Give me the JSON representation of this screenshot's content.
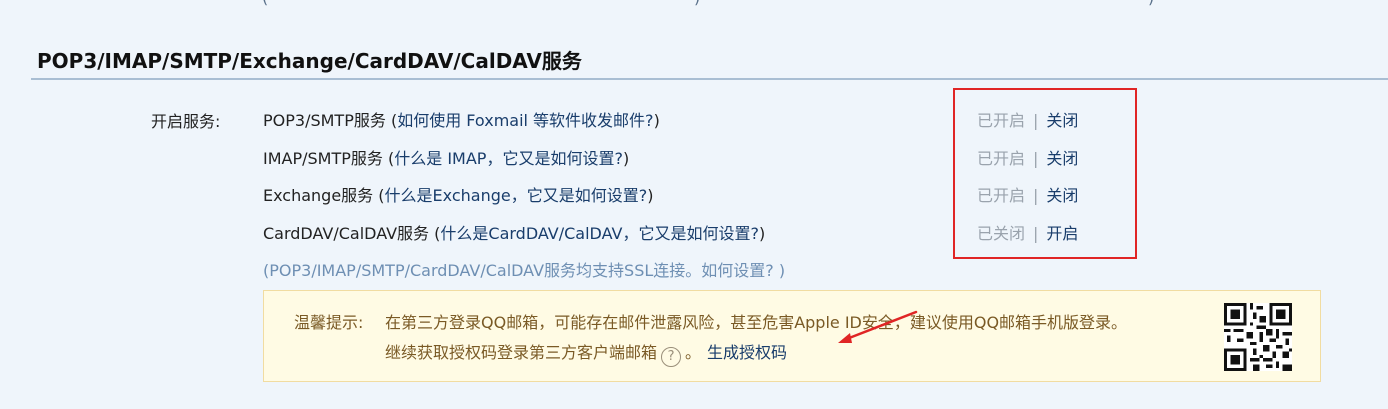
{
  "top_clip": {
    "left_paren": "(",
    "mid_paren": ")",
    "right_paren": ")"
  },
  "section": {
    "title": "POP3/IMAP/SMTP/Exchange/CardDAV/CalDAV服务"
  },
  "services": {
    "label": "开启服务:",
    "rows": [
      {
        "name": "POP3/SMTP服务",
        "open_paren": "(",
        "help": "如何使用 Foxmail 等软件收发邮件?",
        "close_paren": ")",
        "state": "已开启",
        "sep": "|",
        "action": "关闭"
      },
      {
        "name": "IMAP/SMTP服务",
        "open_paren": "(",
        "help": "什么是 IMAP，它又是如何设置?",
        "close_paren": ")",
        "state": "已开启",
        "sep": "|",
        "action": "关闭"
      },
      {
        "name": "Exchange服务",
        "open_paren": "(",
        "help": "什么是Exchange，它又是如何设置?",
        "close_paren": ")",
        "state": "已开启",
        "sep": "|",
        "action": "关闭"
      },
      {
        "name": "CardDAV/CalDAV服务",
        "open_paren": "(",
        "help": "什么是CardDAV/CalDAV，它又是如何设置?",
        "close_paren": ")",
        "state": "已关闭",
        "sep": "|",
        "action": "开启"
      }
    ],
    "ssl_note": "(POP3/IMAP/SMTP/CardDAV/CalDAV服务均支持SSL连接。",
    "ssl_link": "如何设置?",
    "ssl_close": " )"
  },
  "tip": {
    "label": "温馨提示:",
    "line1": "在第三方登录QQ邮箱，可能存在邮件泄露风险，甚至危害Apple ID安全，建议使用QQ邮箱手机版登录。",
    "line2": "继续获取授权码登录第三方客户端邮箱",
    "help_glyph": "?",
    "line2_end": "。",
    "generate_link": "生成授权码"
  },
  "colors": {
    "background": "#eff5fb",
    "link": "#193d6b",
    "highlight_border": "#e02525",
    "tip_bg": "#fffbe4",
    "tip_text": "#7a5a25"
  },
  "icons": {
    "help": "help-circle-icon",
    "qr": "qr-code-icon",
    "annotation": "red-arrow-icon"
  }
}
